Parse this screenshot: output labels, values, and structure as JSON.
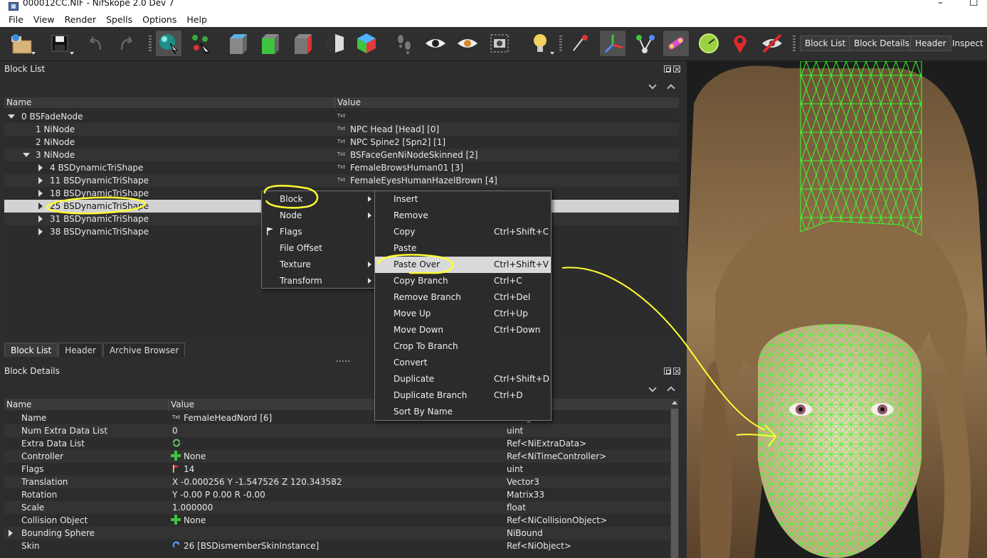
{
  "window": {
    "title": "000012CC.NIF - NifSkope 2.0 Dev 7",
    "minimize": "–",
    "maximize": "☐"
  },
  "menu": [
    "File",
    "View",
    "Render",
    "Spells",
    "Options",
    "Help"
  ],
  "toolbar": {
    "text_buttons": [
      "Block List",
      "Block Details",
      "Header",
      "Inspect"
    ]
  },
  "block_list": {
    "title": "Block List",
    "columns": [
      "Name",
      "Value"
    ],
    "rows": [
      {
        "name": "0 BSFadeNode",
        "value": ""
      },
      {
        "name": "1 NiNode",
        "value": "NPC Head [Head] [0]"
      },
      {
        "name": "2 NiNode",
        "value": "NPC Spine2 [Spn2] [1]"
      },
      {
        "name": "3 NiNode",
        "value": "BSFaceGenNiNodeSkinned [2]"
      },
      {
        "name": "4 BSDynamicTriShape",
        "value": "FemaleBrowsHuman01 [3]"
      },
      {
        "name": "11 BSDynamicTriShape",
        "value": "FemaleEyesHumanHazelBrown [4]"
      },
      {
        "name": "18 BSDynamicTriShape",
        "value": ""
      },
      {
        "name": "25 BSDynamicTriShape",
        "value": ""
      },
      {
        "name": "31 BSDynamicTriShape",
        "value": ""
      },
      {
        "name": "38 BSDynamicTriShape",
        "value": ""
      }
    ],
    "value_icon": "Txt"
  },
  "bottom_tabs": [
    "Block List",
    "Header",
    "Archive Browser"
  ],
  "block_details": {
    "title": "Block Details",
    "columns": [
      "Name",
      "Value"
    ],
    "rows": [
      {
        "name": "Name",
        "value": "FemaleHeadNord [6]",
        "type": "string"
      },
      {
        "name": "Num Extra Data List",
        "value": "0",
        "type": "uint"
      },
      {
        "name": "Extra Data List",
        "value": "",
        "type": "Ref<NiExtraData>"
      },
      {
        "name": "Controller",
        "value": "None",
        "type": "Ref<NiTimeController>"
      },
      {
        "name": "Flags",
        "value": "14",
        "type": "uint"
      },
      {
        "name": "Translation",
        "value": "X -0.000256 Y -1.547526 Z 120.343582",
        "type": "Vector3"
      },
      {
        "name": "Rotation",
        "value": "Y -0.00 P 0.00 R -0.00",
        "type": "Matrix33"
      },
      {
        "name": "Scale",
        "value": "1.000000",
        "type": "float"
      },
      {
        "name": "Collision Object",
        "value": "None",
        "type": "Ref<NiCollisionObject>"
      },
      {
        "name": "Bounding Sphere",
        "value": "",
        "type": "NiBound"
      },
      {
        "name": "Skin",
        "value": "26 [BSDismemberSkinInstance]",
        "type": "Ref<NiObject>"
      }
    ]
  },
  "context_menu": {
    "items": [
      "Block",
      "Node",
      "Flags",
      "File Offset",
      "Texture",
      "Transform"
    ]
  },
  "block_submenu": {
    "items": [
      {
        "label": "Insert",
        "shortcut": ""
      },
      {
        "label": "Remove",
        "shortcut": ""
      },
      {
        "label": "Copy",
        "shortcut": "Ctrl+Shift+C"
      },
      {
        "label": "Paste",
        "shortcut": ""
      },
      {
        "label": "Paste Over",
        "shortcut": "Ctrl+Shift+V"
      },
      {
        "label": "Copy Branch",
        "shortcut": "Ctrl+C"
      },
      {
        "label": "Remove Branch",
        "shortcut": "Ctrl+Del"
      },
      {
        "label": "Move Up",
        "shortcut": "Ctrl+Up"
      },
      {
        "label": "Move Down",
        "shortcut": "Ctrl+Down"
      },
      {
        "label": "Crop To Branch",
        "shortcut": ""
      },
      {
        "label": "Convert",
        "shortcut": ""
      },
      {
        "label": "Duplicate",
        "shortcut": "Ctrl+Shift+D"
      },
      {
        "label": "Duplicate Branch",
        "shortcut": "Ctrl+D"
      },
      {
        "label": "Sort By Name",
        "shortcut": ""
      }
    ]
  },
  "colors": {
    "annotation": "#ffff33",
    "wireframe": "#39ff2a",
    "hair": "#8a6a45",
    "skin": "#e8c9b0"
  }
}
